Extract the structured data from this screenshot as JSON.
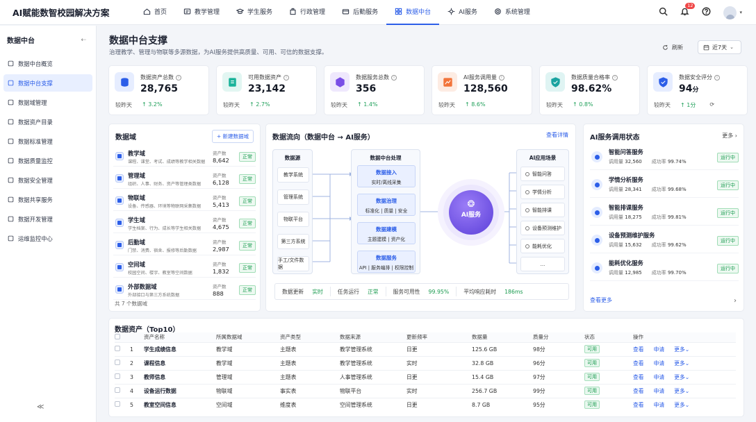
{
  "app": {
    "title": "AI赋能数智校园解决方案"
  },
  "nav": [
    {
      "label": "首页",
      "icon": "home-icon"
    },
    {
      "label": "教学管理",
      "icon": "teaching-icon"
    },
    {
      "label": "学生服务",
      "icon": "student-icon"
    },
    {
      "label": "行政管理",
      "icon": "admin-icon"
    },
    {
      "label": "后勤服务",
      "icon": "logistics-icon"
    },
    {
      "label": "数据中台",
      "icon": "data-platform-icon",
      "active": true
    },
    {
      "label": "AI服务",
      "icon": "ai-icon"
    },
    {
      "label": "系统管理",
      "icon": "settings-icon"
    }
  ],
  "header": {
    "notification_count": "12"
  },
  "sidebar": {
    "title": "数据中台",
    "collapse": "⇠",
    "items": [
      "数据中台概览",
      "数据中台支撑",
      "数据域管理",
      "数据资产目录",
      "数据标准管理",
      "数据质量监控",
      "数据安全管理",
      "数据共享服务",
      "数据开发管理",
      "运维监控中心"
    ],
    "active_index": 1,
    "bottom": "≪"
  },
  "page": {
    "title": "数据中台支撑",
    "subtitle": "治理教学、管理与物联等多源数据，为AI服务提供高质量、可用、可信的数据支撑。",
    "refresh": "刷新",
    "daterange": "近7天"
  },
  "kpis": [
    {
      "label": "数据资产总数",
      "value": "28,765",
      "unit": "",
      "foot": "较昨天",
      "change": "↑ 3.2%",
      "color": "#2c5ee8",
      "bg": "#e6edff",
      "icon": "database-icon"
    },
    {
      "label": "可用数据资产",
      "value": "23,142",
      "unit": "",
      "foot": "较昨天",
      "change": "↑ 2.7%",
      "color": "#1bb39a",
      "bg": "#e2f6f2",
      "icon": "document-icon"
    },
    {
      "label": "数据服务总数",
      "value": "356",
      "unit": "",
      "foot": "较昨天",
      "change": "↑ 1.4%",
      "color": "#7a4ee6",
      "bg": "#efe8fd",
      "icon": "cube-icon"
    },
    {
      "label": "AI服务调用量",
      "value": "128,560",
      "unit": "",
      "foot": "较昨天",
      "change": "↑ 8.6%",
      "color": "#f2743a",
      "bg": "#fdece3",
      "icon": "chart-icon"
    },
    {
      "label": "数据质量合格率",
      "value": "98.62%",
      "unit": "",
      "foot": "较昨天",
      "change": "↑ 0.8%",
      "color": "#1aa3a0",
      "bg": "#dff4f3",
      "icon": "shield-check-icon"
    },
    {
      "label": "数据安全评分",
      "value": "94",
      "unit": "分",
      "foot": "较昨天",
      "change": "↑ 1分",
      "color": "#2c5ee8",
      "bg": "#e6edff",
      "icon": "shield-icon",
      "ref": "⟳"
    }
  ],
  "domains": {
    "title": "数据域",
    "add": "+ 新建数据域",
    "count_label": "资产数",
    "status": "正常",
    "items": [
      {
        "name": "教学域",
        "desc": "课程、课堂、考试、成绩等教学相关数据",
        "count": "8,642"
      },
      {
        "name": "管理域",
        "desc": "组织、人事、财务、资产等管理类数据",
        "count": "6,128"
      },
      {
        "name": "物联域",
        "desc": "设备、传感器、环境等物联网采集数据",
        "count": "5,413"
      },
      {
        "name": "学生域",
        "desc": "学生档案、行为、成长等学生相关数据",
        "count": "4,675"
      },
      {
        "name": "后勤域",
        "desc": "门禁、消费、宿舍、报修等后勤数据",
        "count": "2,987"
      },
      {
        "name": "空间域",
        "desc": "校园空间、楼宇、教室等空间数据",
        "count": "1,832"
      },
      {
        "name": "外部数据域",
        "desc": "外部接口与第三方系统数据",
        "count": "888"
      }
    ],
    "footer": "共 7 个数据域"
  },
  "flow": {
    "title": "数据流向（数据中台 → AI服务）",
    "detail": "查看详情",
    "source_title": "数据源",
    "sources": [
      "教学系统",
      "管理系统",
      "物联平台",
      "第三方系统",
      "手工/文件数据"
    ],
    "proc_title": "数据中台处理",
    "procs": [
      {
        "title": "数据接入",
        "sub": "实时/离线采集"
      },
      {
        "title": "数据治理",
        "sub": "标准化 | 质量 | 安全"
      },
      {
        "title": "数据建模",
        "sub": "主题建模 | 资产化"
      },
      {
        "title": "数据服务",
        "sub": "API | 服务编排 | 权限控制"
      }
    ],
    "ai_label": "AI服务",
    "app_title": "AI应用场景",
    "apps": [
      "智能问答",
      "学情分析",
      "智能排课",
      "设备预测维护",
      "能耗优化",
      "..."
    ],
    "status": [
      {
        "label": "数据更新",
        "value": "实时"
      },
      {
        "label": "任务运行",
        "value": "正常"
      },
      {
        "label": "服务可用性",
        "value": "99.95%"
      },
      {
        "label": "平均响应耗时",
        "value": "186ms"
      }
    ]
  },
  "ai_status": {
    "title": "AI服务调用状态",
    "more": "更多 ›",
    "calls_label": "调用量",
    "rate_label": "成功率",
    "status": "运行中",
    "items": [
      {
        "name": "智能问答服务",
        "calls": "32,560",
        "rate": "99.74%"
      },
      {
        "name": "学情分析服务",
        "calls": "28,341",
        "rate": "99.68%"
      },
      {
        "name": "智能排课服务",
        "calls": "18,275",
        "rate": "99.81%"
      },
      {
        "name": "设备预测维护服务",
        "calls": "15,632",
        "rate": "99.62%"
      },
      {
        "name": "能耗优化服务",
        "calls": "12,985",
        "rate": "99.70%"
      }
    ],
    "view_more": "查看更多",
    "arrow": "›"
  },
  "assets": {
    "title": "数据资产（Top10）",
    "columns": [
      "资产名称",
      "所属数据域",
      "资产类型",
      "数据来源",
      "更新频率",
      "数据量",
      "质量分",
      "状态",
      "操作"
    ],
    "rows": [
      {
        "no": "1",
        "name": "学生成绩信息",
        "domain": "教学域",
        "type": "主题表",
        "source": "教学管理系统",
        "freq": "日更",
        "size": "125.6 GB",
        "score": "98分",
        "status": "可用"
      },
      {
        "no": "2",
        "name": "课程信息",
        "domain": "教学域",
        "type": "主题表",
        "source": "教学管理系统",
        "freq": "实时",
        "size": "32.8 GB",
        "score": "96分",
        "status": "可用"
      },
      {
        "no": "3",
        "name": "教师信息",
        "domain": "管理域",
        "type": "主题表",
        "source": "人事管理系统",
        "freq": "日更",
        "size": "15.4 GB",
        "score": "97分",
        "status": "可用"
      },
      {
        "no": "4",
        "name": "设备运行数据",
        "domain": "物联域",
        "type": "事实表",
        "source": "物联平台",
        "freq": "实时",
        "size": "256.7 GB",
        "score": "99分",
        "status": "可用"
      },
      {
        "no": "5",
        "name": "教室空间信息",
        "domain": "空间域",
        "type": "维度表",
        "source": "空间管理系统",
        "freq": "日更",
        "size": "8.7 GB",
        "score": "95分",
        "status": "可用"
      }
    ],
    "actions": {
      "view": "查看",
      "apply": "申请",
      "more": "更多⌄"
    }
  }
}
